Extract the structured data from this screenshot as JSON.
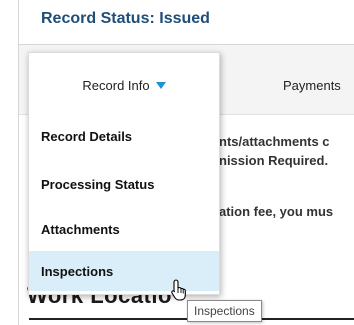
{
  "record": {
    "status_title": "Record Status: Issued"
  },
  "tabs": {
    "payments_label": "Payments"
  },
  "menu": {
    "head_label": "Record Info",
    "items": [
      {
        "label": "Record Details"
      },
      {
        "label": "Processing Status"
      },
      {
        "label": "Attachments"
      },
      {
        "label": "Inspections",
        "hovered": true
      }
    ]
  },
  "body": {
    "line1": "nts/attachments c",
    "line2": "nission Required.",
    "line3": "ation fee, you mus"
  },
  "section": {
    "heading": "Work Locatio"
  },
  "tooltip": {
    "text": "Inspections"
  },
  "colors": {
    "title": "#1f4e79",
    "caret": "#1e90d6",
    "hover_bg": "#d9eef8"
  },
  "icons": {
    "menu_caret": "caret-down-icon",
    "pointer": "hand-pointer-icon"
  }
}
